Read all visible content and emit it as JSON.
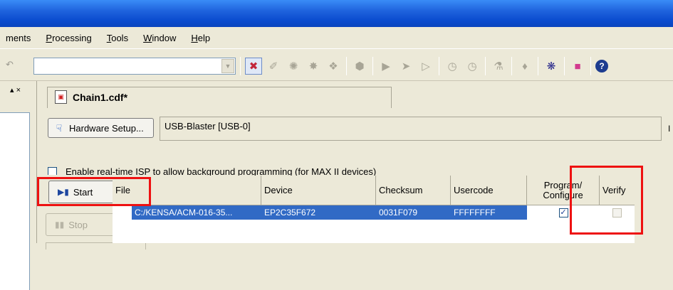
{
  "menu": {
    "items": [
      {
        "label": "ments"
      },
      {
        "label": "Processing",
        "accel": "P",
        "rest": "rocessing"
      },
      {
        "label": "Tools",
        "accel": "T",
        "rest": "ools"
      },
      {
        "label": "Window",
        "accel": "W",
        "rest": "indow"
      },
      {
        "label": "Help",
        "accel": "H",
        "rest": "elp"
      }
    ]
  },
  "toolbar": {
    "combo_value": "",
    "icons": [
      "start-compilation-icon",
      "analysis-icon",
      "fitter-icon",
      "assembler-icon",
      "timing-icon",
      "stop-icon",
      "play-icon",
      "step-icon",
      "step-over-icon",
      "timer-icon",
      "clock-icon",
      "rtl-icon",
      "chip-icon",
      "programmer-icon",
      "sopc-icon",
      "help-icon"
    ],
    "help_glyph": "?"
  },
  "left_panel": {
    "head_glyphs": "▴ ×"
  },
  "tab": {
    "label": "Chain1.cdf*"
  },
  "hardware": {
    "button_label": "Hardware Setup...",
    "value": "USB-Blaster [USB-0]",
    "right_edge": "I"
  },
  "isp": {
    "label": "Enable real-time ISP to allow background programming (for MAX II devices)",
    "checked": false
  },
  "controls": {
    "start_label": "Start",
    "stop_label": "Stop"
  },
  "grid": {
    "columns": [
      "File",
      "Device",
      "Checksum",
      "Usercode",
      "Program/\nConfigure",
      "Verify"
    ],
    "rows": [
      {
        "file": "C:/KENSA/ACM-016-35...",
        "device": "EP2C35F672",
        "checksum": "0031F079",
        "usercode": "FFFFFFFF",
        "program": true
      }
    ]
  },
  "colors": {
    "title_bar": "#0b4ccf",
    "selection": "#316ac5",
    "highlight_box": "#ee1111"
  }
}
